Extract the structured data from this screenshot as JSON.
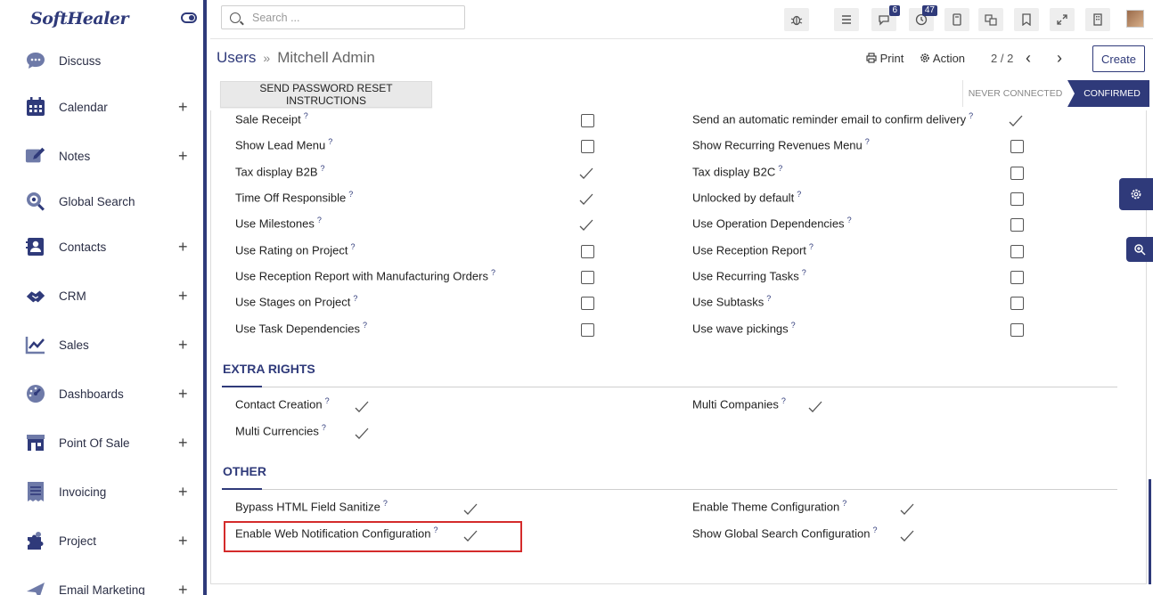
{
  "app": {
    "logo": "SoftHealer"
  },
  "sidebar": {
    "items": [
      {
        "label": "Discuss",
        "icon": "chat-bubble-icon",
        "has_plus": false
      },
      {
        "label": "Calendar",
        "icon": "calendar-icon",
        "has_plus": true
      },
      {
        "label": "Notes",
        "icon": "notes-icon",
        "has_plus": true
      },
      {
        "label": "Global Search",
        "icon": "global-search-icon",
        "has_plus": false
      },
      {
        "label": "Contacts",
        "icon": "contacts-icon",
        "has_plus": true
      },
      {
        "label": "CRM",
        "icon": "handshake-icon",
        "has_plus": true
      },
      {
        "label": "Sales",
        "icon": "sales-chart-icon",
        "has_plus": true
      },
      {
        "label": "Dashboards",
        "icon": "dashboard-gauge-icon",
        "has_plus": true
      },
      {
        "label": "Point Of Sale",
        "icon": "store-icon",
        "has_plus": true
      },
      {
        "label": "Invoicing",
        "icon": "invoice-icon",
        "has_plus": true
      },
      {
        "label": "Project",
        "icon": "puzzle-icon",
        "has_plus": true
      },
      {
        "label": "Email Marketing",
        "icon": "paper-plane-icon",
        "has_plus": true
      }
    ],
    "plus_symbol": "+"
  },
  "topbar": {
    "search_placeholder": "Search ...",
    "messages_count": "6",
    "activities_count": "47"
  },
  "control_panel": {
    "breadcrumb_parent": "Users",
    "breadcrumb_separator": "»",
    "breadcrumb_current": "Mitchell Admin",
    "print_label": "Print",
    "action_label": "Action",
    "pager": "2 / 2",
    "prev_symbol": "‹",
    "next_symbol": "›",
    "create_label": "Create"
  },
  "form_header": {
    "reset_button": "SEND PASSWORD RESET INSTRUCTIONS",
    "status_never": "NEVER CONNECTED",
    "status_confirmed": "CONFIRMED",
    "active_status": "CONFIRMED"
  },
  "help_marker": "?",
  "technical_rights": {
    "left": [
      {
        "label": "Sale Receipt",
        "checked": false
      },
      {
        "label": "Show Lead Menu",
        "checked": false
      },
      {
        "label": "Tax display B2B",
        "checked": true
      },
      {
        "label": "Time Off Responsible",
        "checked": true
      },
      {
        "label": "Use Milestones",
        "checked": true
      },
      {
        "label": "Use Rating on Project",
        "checked": false
      },
      {
        "label": "Use Reception Report with Manufacturing Orders",
        "checked": false
      },
      {
        "label": "Use Stages on Project",
        "checked": false
      },
      {
        "label": "Use Task Dependencies",
        "checked": false
      }
    ],
    "right": [
      {
        "label": "Send an automatic reminder email to confirm delivery",
        "checked": true
      },
      {
        "label": "Show Recurring Revenues Menu",
        "checked": false
      },
      {
        "label": "Tax display B2C",
        "checked": false
      },
      {
        "label": "Unlocked by default",
        "checked": false
      },
      {
        "label": "Use Operation Dependencies",
        "checked": false
      },
      {
        "label": "Use Reception Report",
        "checked": false
      },
      {
        "label": "Use Recurring Tasks",
        "checked": false
      },
      {
        "label": "Use Subtasks",
        "checked": false
      },
      {
        "label": "Use wave pickings",
        "checked": false
      }
    ]
  },
  "extra_rights": {
    "title": "EXTRA RIGHTS",
    "items": [
      {
        "label": "Contact Creation",
        "checked": true
      },
      {
        "label": "Multi Companies",
        "checked": true
      },
      {
        "label": "Multi Currencies",
        "checked": true
      }
    ]
  },
  "other": {
    "title": "OTHER",
    "items": [
      {
        "label": "Bypass HTML Field Sanitize",
        "checked": true
      },
      {
        "label": "Enable Theme Configuration",
        "checked": true
      },
      {
        "label": "Enable Web Notification Configuration",
        "checked": true,
        "highlighted": true
      },
      {
        "label": "Show Global Search Configuration",
        "checked": true
      }
    ]
  },
  "colors": {
    "brand": "#2f3a7a",
    "highlight": "#d42b2b"
  }
}
